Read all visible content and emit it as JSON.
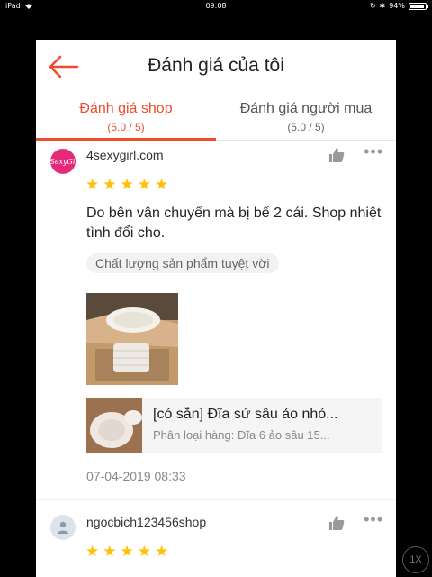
{
  "status_bar": {
    "device": "iPad",
    "time": "09:08",
    "battery": "94%",
    "battery_level": 0.94
  },
  "header": {
    "title": "Đánh giá của tôi",
    "back_icon": "arrow-left-icon",
    "accent_color": "#ee4d2d"
  },
  "tabs": [
    {
      "label": "Đánh giá shop",
      "sub": "(5.0 / 5)",
      "active": true
    },
    {
      "label": "Đánh giá người mua",
      "sub": "(5.0 / 5)",
      "active": false
    }
  ],
  "reviews": [
    {
      "username": "4sexygirl.com",
      "avatar_text": "4SexyGirl",
      "rating": 5,
      "comment": "Do bên vận chuyển mà bị bể 2 cái. Shop nhiệt tình đổi cho.",
      "tag": "Chất lượng sản phẩm tuyệt vời",
      "product": {
        "name": "[có sẵn] Đĩa sứ sâu ảo nhỏ...",
        "variant": "Phân loại hàng: Đĩa 6 ảo sâu 15..."
      },
      "date": "07-04-2019 08:33"
    },
    {
      "username": "ngocbich123456shop",
      "rating": 5
    }
  ],
  "overlay": {
    "speed_badge": "1X"
  },
  "icons": {
    "like": "thumbs-up-icon",
    "more": "more-dots-icon",
    "star": "star-icon"
  }
}
